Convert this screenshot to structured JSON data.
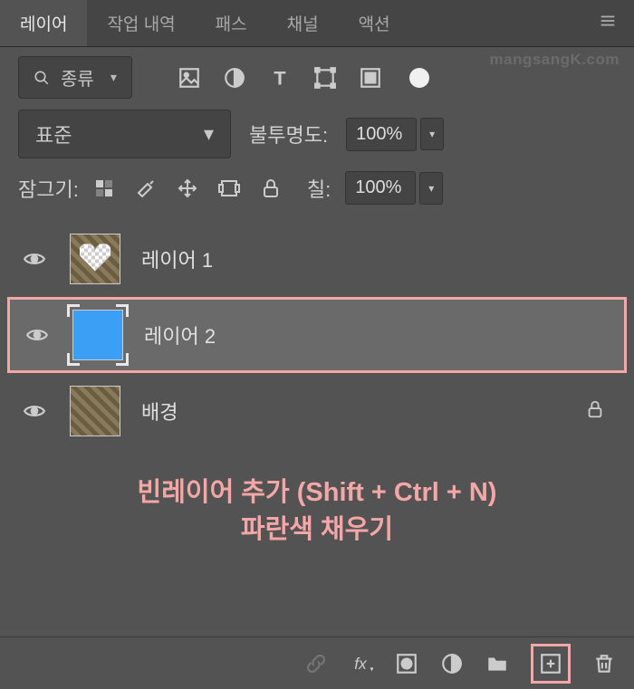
{
  "tabs": {
    "items": [
      {
        "label": "레이어",
        "active": true
      },
      {
        "label": "작업 내역",
        "active": false
      },
      {
        "label": "패스",
        "active": false
      },
      {
        "label": "채널",
        "active": false
      },
      {
        "label": "액션",
        "active": false
      }
    ]
  },
  "watermark": "mangsangK.com",
  "filter": {
    "search_icon": "search",
    "label": "종류"
  },
  "blend": {
    "mode": "표준",
    "opacity_label": "불투명도:",
    "opacity_value": "100%"
  },
  "lock": {
    "label": "잠그기:",
    "fill_label": "칠:",
    "fill_value": "100%"
  },
  "layers": [
    {
      "name": "레이어 1",
      "thumb": "heart",
      "selected": false,
      "highlighted": false,
      "locked": false
    },
    {
      "name": "레이어 2",
      "thumb": "blue",
      "selected": true,
      "highlighted": true,
      "locked": false
    },
    {
      "name": "배경",
      "thumb": "stone",
      "selected": false,
      "highlighted": false,
      "locked": true
    }
  ],
  "annotation": {
    "line1": "빈레이어 추가 (Shift + Ctrl + N)",
    "line2": "파란색 채우기"
  },
  "bottom_icons": {
    "link": "link-icon",
    "fx": "fx-icon",
    "mask": "mask-icon",
    "adjust": "adjustment-icon",
    "group": "group-icon",
    "new": "new-layer-icon",
    "trash": "trash-icon"
  }
}
